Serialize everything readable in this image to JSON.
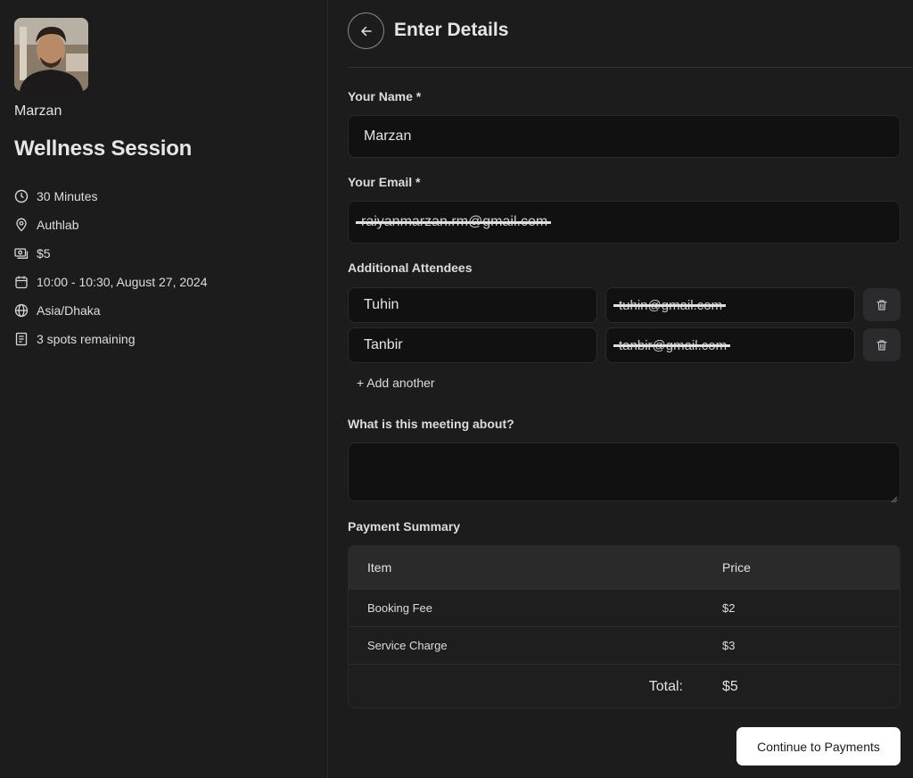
{
  "sidebar": {
    "host_name": "Marzan",
    "avatar_alt": "Host avatar",
    "event_title": "Wellness Session",
    "meta": [
      {
        "icon": "clock-icon",
        "text": "30 Minutes"
      },
      {
        "icon": "location-pin-icon",
        "text": "Authlab"
      },
      {
        "icon": "money-icon",
        "text": "$5"
      },
      {
        "icon": "calendar-icon",
        "text": "10:00 - 10:30, August 27, 2024"
      },
      {
        "icon": "globe-icon",
        "text": "Asia/Dhaka"
      },
      {
        "icon": "document-icon",
        "text": "3 spots remaining"
      }
    ]
  },
  "header": {
    "back_icon": "arrow-left-icon",
    "title": "Enter Details"
  },
  "form": {
    "name": {
      "label": "Your Name *",
      "value": "Marzan"
    },
    "email": {
      "label": "Your Email *",
      "value": "raiyanmarzan.rm@gmail.com",
      "redacted": true
    },
    "attendees": {
      "label": "Additional Attendees",
      "rows": [
        {
          "name": "Tuhin",
          "email": "tuhin@gmail.com"
        },
        {
          "name": "Tanbir",
          "email": "tanbir@gmail.com"
        }
      ],
      "add_label": "+ Add another"
    },
    "about": {
      "label": "What is this meeting about?",
      "value": ""
    }
  },
  "payment": {
    "label": "Payment Summary",
    "columns": [
      "Item",
      "Price"
    ],
    "rows": [
      {
        "item": "Booking Fee",
        "price": "$2"
      },
      {
        "item": "Service Charge",
        "price": "$3"
      }
    ],
    "total_label": "Total:",
    "total_value": "$5"
  },
  "actions": {
    "continue_label": "Continue to Payments"
  },
  "colors": {
    "background": "#1c1c1d",
    "input_bg": "#111112",
    "primary_button_bg": "#ffffff",
    "primary_button_text": "#1a1a1a"
  }
}
